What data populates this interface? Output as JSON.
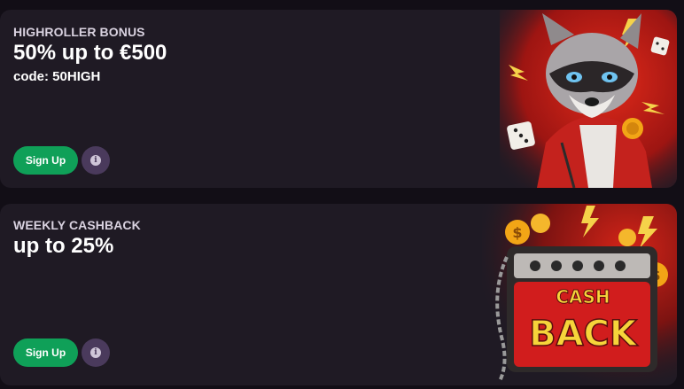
{
  "promos": [
    {
      "title": "HIGHROLLER BONUS",
      "headline": "50% up to €500",
      "code": "code: 50HIGH",
      "signup_label": "Sign Up",
      "info_glyph": "i",
      "art_icon": "raccoon-mascot-icon"
    },
    {
      "title": "WEEKLY CASHBACK",
      "headline": "up to 25%",
      "signup_label": "Sign Up",
      "info_glyph": "i",
      "art_icon": "cashback-box-icon",
      "art_text_1": "CASH",
      "art_text_2": "BACK"
    }
  ],
  "colors": {
    "background": "#120e16",
    "card": "#1f1a24",
    "signup_button": "#0fa058",
    "info_button": "#4a3a5c",
    "accent_red": "#c6161d",
    "accent_gold": "#f2a516"
  }
}
